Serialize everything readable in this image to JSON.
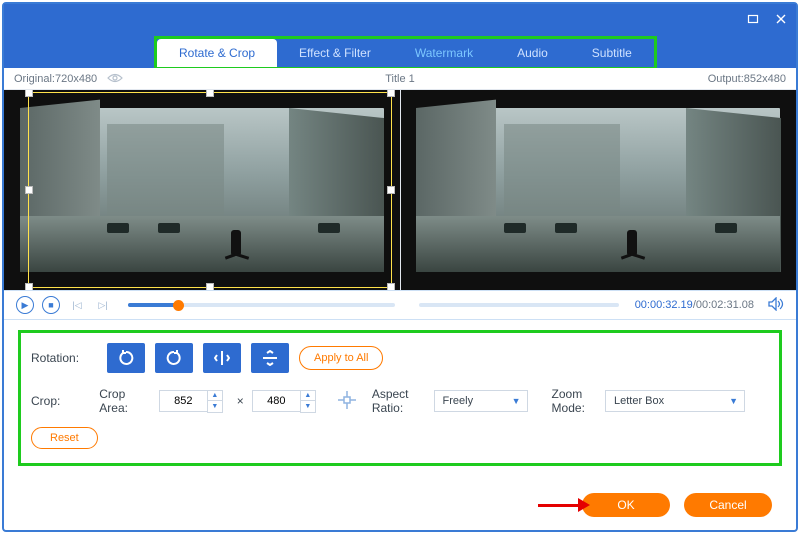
{
  "window": {
    "minimize": "☐",
    "close": "✕"
  },
  "tabs": {
    "rotate_crop": "Rotate & Crop",
    "effect_filter": "Effect & Filter",
    "watermark": "Watermark",
    "audio": "Audio",
    "subtitle": "Subtitle"
  },
  "info": {
    "original_label": "Original: ",
    "original_dims": "720x480",
    "title": "Title 1",
    "output_label": "Output: ",
    "output_dims": "852x480"
  },
  "playback": {
    "current": "00:00:32.19",
    "sep": "/",
    "duration": "00:02:31.08"
  },
  "panel": {
    "rotation_label": "Rotation:",
    "apply_all": "Apply to All",
    "crop_label": "Crop:",
    "crop_area_label": "Crop Area:",
    "crop_w": "852",
    "crop_h": "480",
    "aspect_label": "Aspect Ratio:",
    "aspect_value": "Freely",
    "zoom_label": "Zoom Mode:",
    "zoom_value": "Letter Box",
    "reset": "Reset"
  },
  "footer": {
    "ok": "OK",
    "cancel": "Cancel"
  }
}
